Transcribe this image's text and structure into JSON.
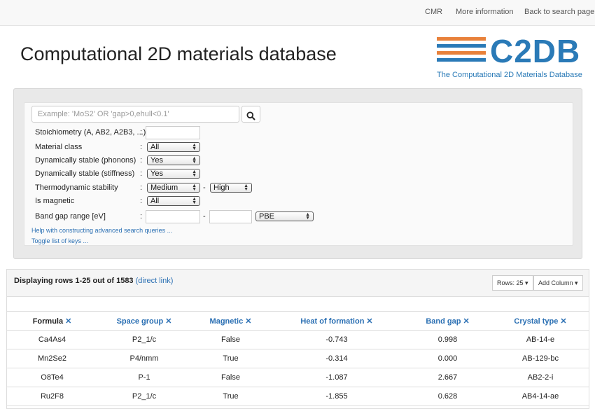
{
  "nav": {
    "cmr": "CMR",
    "more": "More information",
    "back": "Back to search page"
  },
  "title": "Computational 2D materials database",
  "logo": {
    "word": "C2DB",
    "subtitle": "The Computational 2D Materials Database",
    "stripe_colors": [
      "#e8813a",
      "#2a7ab7",
      "#e8813a",
      "#2a7ab7"
    ]
  },
  "search": {
    "placeholder": "Example: 'MoS2' OR 'gap>0,ehull<0.1'",
    "button_icon": "search-icon"
  },
  "filters": {
    "stoichiometry": {
      "label": "Stoichiometry (A, AB2, A2B3, ...)",
      "value": ""
    },
    "material_class": {
      "label": "Material class",
      "value": "All"
    },
    "dyn_phonons": {
      "label": "Dynamically stable (phonons)",
      "value": "Yes"
    },
    "dyn_stiffness": {
      "label": "Dynamically stable (stiffness)",
      "value": "Yes"
    },
    "thermo": {
      "label": "Thermodynamic stability",
      "from": "Medium",
      "to": "High"
    },
    "magnetic": {
      "label": "Is magnetic",
      "value": "All"
    },
    "band_gap": {
      "label": "Band gap range [eV]",
      "min": "",
      "max": "",
      "method": "PBE"
    },
    "colon": ":",
    "dash": "-"
  },
  "links": {
    "help": "Help with constructing advanced search queries ...",
    "toggle": "Toggle list of keys ..."
  },
  "results": {
    "displaying": "Displaying rows 1-25 out of 1583",
    "direct_link": "(direct link)",
    "rows_button": "Rows: 25 ▾",
    "add_column": "Add Column ▾"
  },
  "table": {
    "columns": [
      "Formula",
      "Space group",
      "Magnetic",
      "Heat of formation",
      "Band gap",
      "Crystal type"
    ],
    "remove_symbol": "✕",
    "rows": [
      [
        "Ca4As4",
        "P2_1/c",
        "False",
        "-0.743",
        "0.998",
        "AB-14-e"
      ],
      [
        "Mn2Se2",
        "P4/nmm",
        "True",
        "-0.314",
        "0.000",
        "AB-129-bc"
      ],
      [
        "O8Te4",
        "P-1",
        "False",
        "-1.087",
        "2.667",
        "AB2-2-i"
      ],
      [
        "Ru2F8",
        "P2_1/c",
        "True",
        "-1.855",
        "0.628",
        "AB4-14-ae"
      ]
    ]
  }
}
